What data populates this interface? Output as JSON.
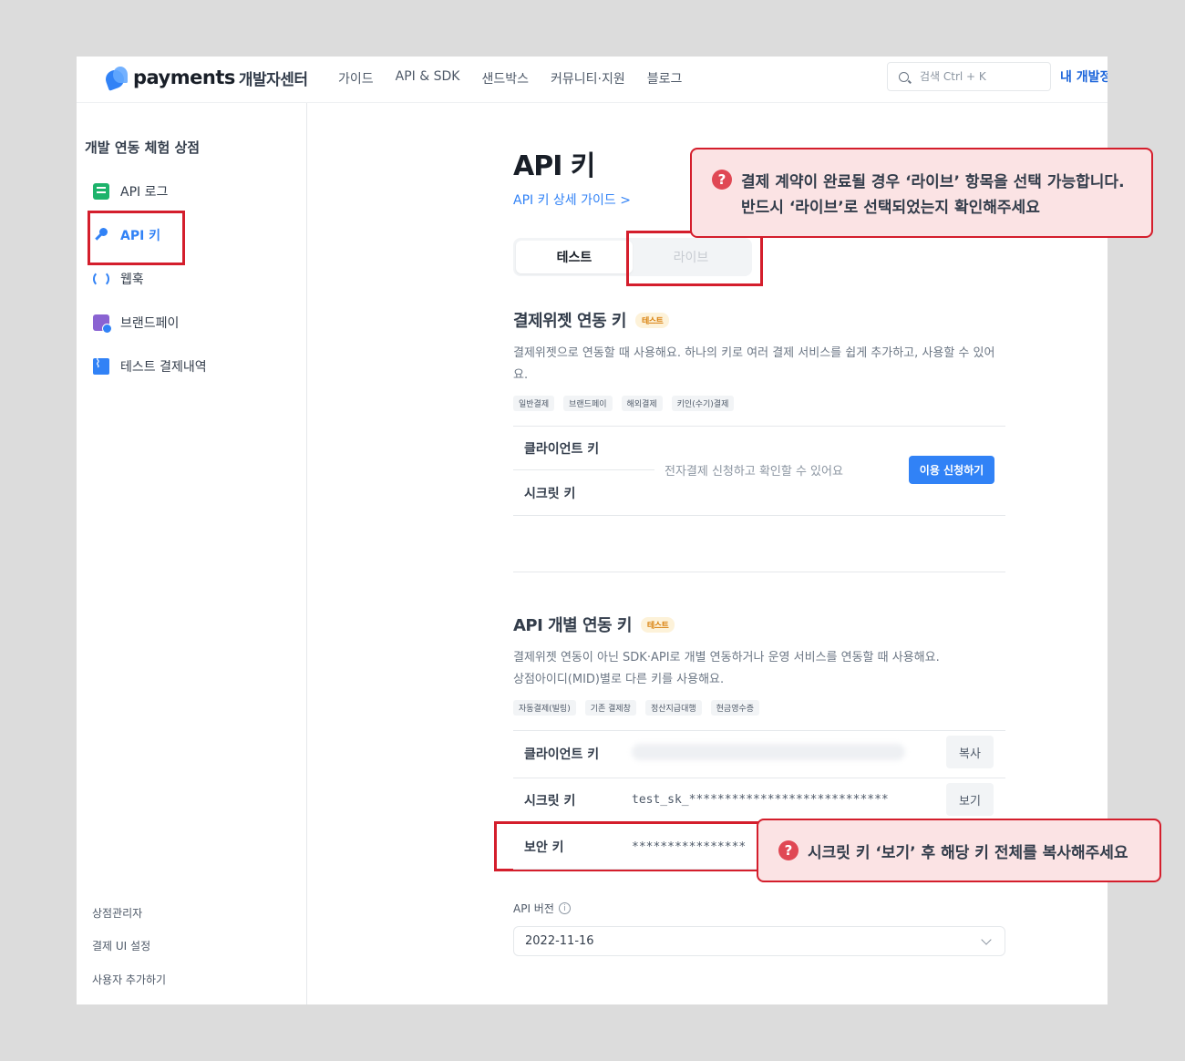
{
  "header": {
    "logo_word": "payments",
    "logo_sub": "개발자센터",
    "nav": [
      "가이드",
      "API & SDK",
      "샌드박스",
      "커뮤니티·지원",
      "블로그"
    ],
    "search_placeholder": "검색 Ctrl + K",
    "my_link": "내 개발정"
  },
  "sidebar": {
    "title": "개발 연동 체험 상점",
    "items": [
      {
        "label": "API 로그",
        "icon": "log-icon"
      },
      {
        "label": "API 키",
        "icon": "key-icon",
        "active": true
      },
      {
        "label": "웹훅",
        "icon": "webhook-icon"
      },
      {
        "label": "브랜드페이",
        "icon": "brandpay-icon"
      },
      {
        "label": "테스트 결제내역",
        "icon": "test-history-icon"
      }
    ],
    "footer": [
      "상점관리자",
      "결제 UI 설정",
      "사용자 추가하기"
    ]
  },
  "main": {
    "title": "API 키",
    "guide_link": "API 키 상세 가이드 >",
    "tabs": [
      {
        "label": "테스트",
        "selected": true
      },
      {
        "label": "라이브",
        "selected": false,
        "disabled": true
      }
    ],
    "widget": {
      "title": "결제위젯 연동 키",
      "badge": "테스트",
      "desc": "결제위젯으로 연동할 때 사용해요. 하나의 키로 여러 결제 서비스를 쉽게 추가하고, 사용할 수 있어요.",
      "chips": [
        "일반결제",
        "브랜드페이",
        "해외결제",
        "키인(수기)결제"
      ],
      "client_label": "클라이언트 키",
      "secret_label": "시크릿 키",
      "notice": "전자결제 신청하고 확인할 수 있어요",
      "apply_button": "이용 신청하기"
    },
    "individual": {
      "title": "API 개별 연동 키",
      "badge": "테스트",
      "desc_line1": "결제위젯 연동이 아닌 SDK·API로 개별 연동하거나 운영 서비스를 연동할 때 사용해요.",
      "desc_line2": "상점아이디(MID)별로 다른 키를 사용해요.",
      "chips": [
        "자동결제(빌링)",
        "기존 결제창",
        "정산지급대행",
        "현금영수증"
      ],
      "client_label": "클라이언트 키",
      "copy_button": "복사",
      "secret_label": "시크릿 키",
      "secret_value": "test_sk_****************************",
      "view_button": "보기",
      "security_label": "보안 키",
      "security_value": "****************"
    },
    "version": {
      "label": "API 버전",
      "value": "2022-11-16"
    }
  },
  "callouts": {
    "live_line1": "결제 계약이 완료될 경우 ‘라이브’ 항목을 선택 가능합니다.",
    "live_line2": "반드시 ‘라이브’로 선택되었는지 확인해주세요",
    "secret": "시크릿 키 ‘보기’ 후 해당 키 전체를 복사해주세요"
  },
  "colors": {
    "accent": "#3182f6",
    "highlight": "#d41e2c",
    "callout_bg": "#fbe3e4"
  }
}
